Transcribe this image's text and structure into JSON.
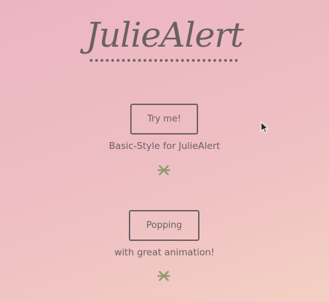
{
  "app": {
    "title": "JulieAlert"
  },
  "sections": [
    {
      "button_label": "Try me!",
      "caption": "Basic-Style for JulieAlert",
      "separator_icon": "asterisk-icon"
    },
    {
      "button_label": "Popping",
      "caption": "with great animation!",
      "separator_icon": "asterisk-icon"
    }
  ],
  "colors": {
    "background_top": "#ecb6c1",
    "background_bottom": "#f4d0c3",
    "text": "#6a6062",
    "separator": "#8f9a6e"
  },
  "cursor_icon": "mouse-pointer-icon"
}
